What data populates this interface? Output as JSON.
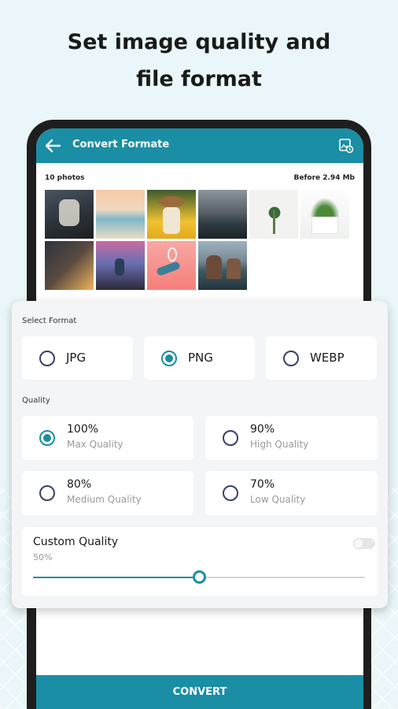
{
  "promo": {
    "line1": "Set image quality and",
    "line2": "file format"
  },
  "app": {
    "title": "Convert Formate",
    "back_icon": "arrow-left-icon",
    "history_icon": "image-history-icon",
    "accent_color": "#1a8ea5"
  },
  "gallery": {
    "count_label": "10 photos",
    "size_label": "Before 2.94 Mb"
  },
  "format": {
    "section_label": "Select Format",
    "options": [
      {
        "label": "JPG",
        "selected": false
      },
      {
        "label": "PNG",
        "selected": true
      },
      {
        "label": "WEBP",
        "selected": false
      }
    ]
  },
  "quality": {
    "section_label": "Quality",
    "options": [
      {
        "value": "100%",
        "caption": "Max Quality",
        "selected": true
      },
      {
        "value": "90%",
        "caption": "High Quality",
        "selected": false
      },
      {
        "value": "80%",
        "caption": "Medium Quality",
        "selected": false
      },
      {
        "value": "70%",
        "caption": "Low Quality",
        "selected": false
      }
    ]
  },
  "custom_quality": {
    "title": "Custom Quality",
    "value_label": "50%",
    "slider_fraction": 0.5,
    "toggle_on": false
  },
  "convert_button": {
    "label": "CONVERT"
  }
}
